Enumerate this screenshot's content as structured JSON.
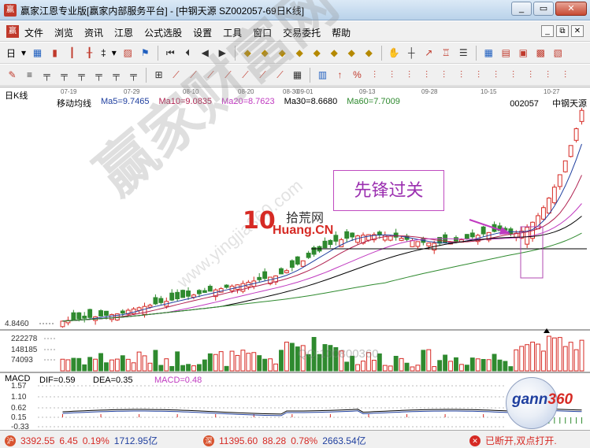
{
  "window": {
    "title": "赢家江恩专业版[赢家内部服务平台] - [中钢天源  SZ002057-69日K线]",
    "min_glyph": "▭",
    "max_glyph": "▭",
    "close_glyph": "✕"
  },
  "menu": {
    "items": [
      "文件",
      "浏览",
      "资讯",
      "江恩",
      "公式选股",
      "设置",
      "工具",
      "窗口",
      "交易委托",
      "帮助"
    ],
    "mdi": [
      "_",
      "⧉",
      "✕"
    ]
  },
  "toolbar1": {
    "period_label": "日",
    "period_caret": "▾",
    "updown_label": "‡",
    "updown_caret": "▾"
  },
  "chart": {
    "period_label": "日K线",
    "indicator_name": "移动均线",
    "ma": [
      {
        "label": "Ma5=9.7465",
        "color": "#1f3f9f"
      },
      {
        "label": "Ma10=9.0835",
        "color": "#b0204f"
      },
      {
        "label": "Ma20=8.7623",
        "color": "#c03ac0"
      },
      {
        "label": "Ma30=8.6680",
        "color": "#000000"
      },
      {
        "label": "Ma60=7.7009",
        "color": "#2f8a2f"
      }
    ],
    "code": "002057",
    "name": "中钢天源",
    "date_ticks": [
      "07-19",
      "07-29",
      "08-10",
      "08-20",
      "08-30",
      "09-01",
      "09-13",
      "09-28",
      "10-15",
      "10-27"
    ],
    "price_low_label": "4.8460",
    "volume_labels": [
      "222278",
      "148185",
      "74093"
    ],
    "annotation": "先锋过关",
    "logo_number": "10",
    "logo_cn": "拾荒网",
    "logo_site": "Huang.CN",
    "watermark": "赢家财富网",
    "watermark_url": "www.yingjia360.com",
    "volume_watermark": "QQ:100800360"
  },
  "macd": {
    "title": "MACD",
    "dif": "DIF=0.59",
    "dea": "DEA=0.35",
    "macd": "MACD=0.48",
    "axis": [
      "1.57",
      "1.10",
      "0.62",
      "0.15",
      "-0.33"
    ]
  },
  "gann": {
    "text": "gann",
    "num": "360"
  },
  "status": {
    "sh_index": "3392.55",
    "sh_change": "6.45",
    "sh_pct": "0.19%",
    "sh_amount": "1712.95亿",
    "sz_index": "11395.60",
    "sz_change": "88.28",
    "sz_pct": "0.78%",
    "sz_amount": "2663.54亿",
    "conn_status": "已断开,双点打开."
  },
  "chart_data": {
    "type": "candlestick",
    "x": [
      "07-19",
      "07-29",
      "08-10",
      "08-20",
      "08-30",
      "09-01",
      "09-13",
      "09-28",
      "10-15",
      "10-27"
    ],
    "ylabel": "",
    "ylim": [
      4.846,
      11.0
    ],
    "price_levels": [
      4.846
    ],
    "volume_levels": [
      74093,
      148185,
      222278
    ],
    "macd_levels": [
      -0.33,
      0.15,
      0.62,
      1.1,
      1.57
    ],
    "series": [
      {
        "name": "Ma5",
        "last": 9.7465
      },
      {
        "name": "Ma10",
        "last": 9.0835
      },
      {
        "name": "Ma20",
        "last": 8.7623
      },
      {
        "name": "Ma30",
        "last": 8.668
      },
      {
        "name": "Ma60",
        "last": 7.7009
      }
    ],
    "macd_values": {
      "DIF": 0.59,
      "DEA": 0.35,
      "MACD": 0.48
    }
  }
}
